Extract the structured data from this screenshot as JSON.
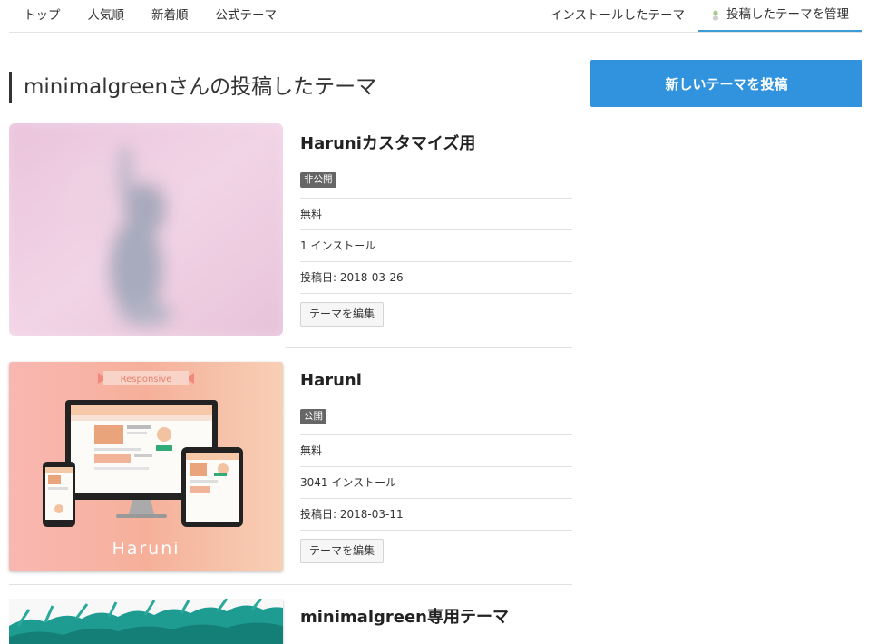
{
  "nav": {
    "left": [
      "トップ",
      "人気順",
      "新着順",
      "公式テーマ"
    ],
    "installed": "インストールしたテーマ",
    "manage": "投稿したテーマを管理"
  },
  "page_title": "minimalgreenさんの投稿したテーマ",
  "post_button": "新しいテーマを投稿",
  "themes": [
    {
      "title": "Haruniカスタマイズ用",
      "status": "非公開",
      "price": "無料",
      "installs": "1 インストール",
      "posted": "投稿日: 2018-03-26",
      "edit": "テーマを編集"
    },
    {
      "title": "Haruni",
      "status": "公開",
      "price": "無料",
      "installs": "3041 インストール",
      "posted": "投稿日: 2018-03-11",
      "edit": "テーマを編集",
      "thumb_banner": "Responsive",
      "thumb_name": "Haruni"
    },
    {
      "title": "minimalgreen専用テーマ"
    }
  ],
  "colors": {
    "accent": "#3193de",
    "badge": "#666666",
    "tab_underline": "#3d9bd6"
  }
}
